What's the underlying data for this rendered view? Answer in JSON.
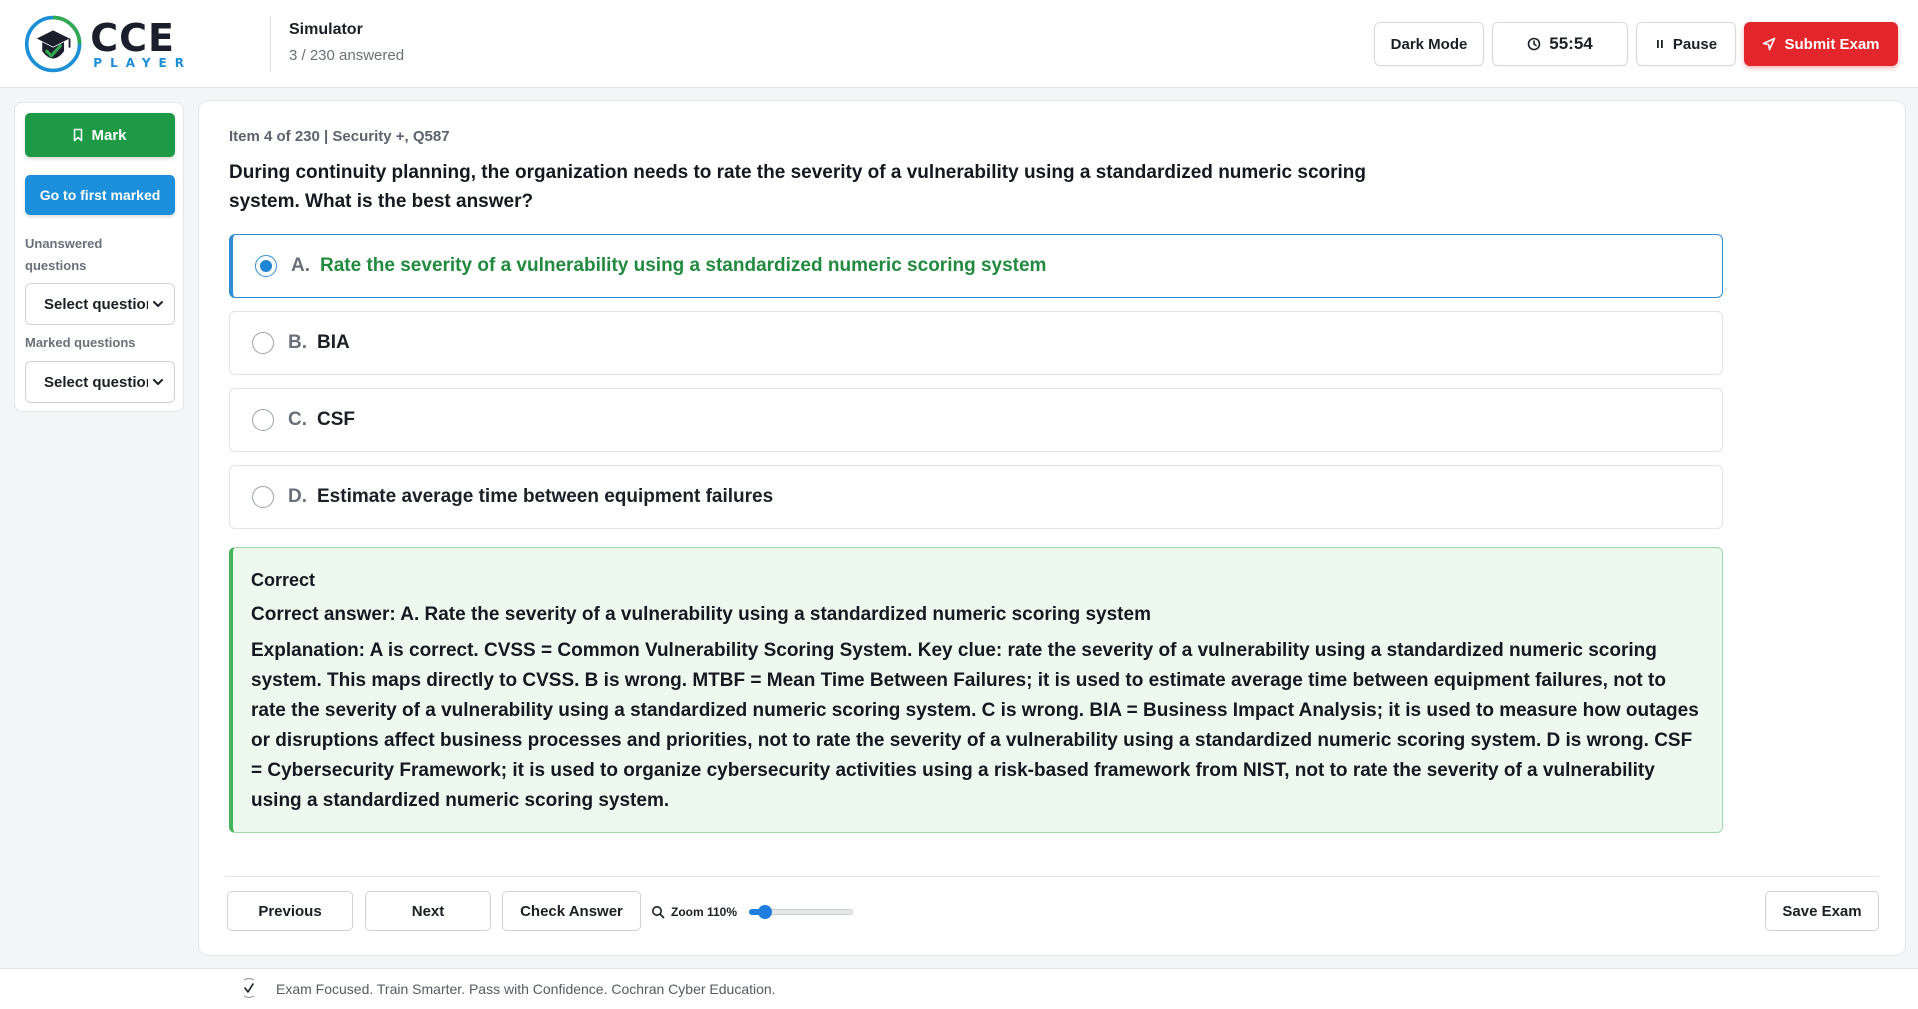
{
  "brand": {
    "name": "CCE",
    "subname": "PLAYER",
    "colors": {
      "navy": "#1a1f2b",
      "blue": "#1d8fd6",
      "green": "#32a852"
    }
  },
  "header": {
    "mode_title": "Simulator",
    "progress": "3 / 230 answered",
    "dark_mode_label": "Dark Mode",
    "timer": "55:54",
    "pause_label": "Pause",
    "submit_label": "Submit Exam",
    "icons": {
      "timer": "clock-icon",
      "pause": "pause-icon",
      "submit": "send-icon"
    }
  },
  "sidebar": {
    "mark_label": "Mark",
    "first_marked_label": "Go to first marked",
    "unanswered_label": "Unanswered questions",
    "unanswered_select": "Select question",
    "marked_label": "Marked questions",
    "marked_select": "Select question",
    "icons": {
      "mark": "bookmark-icon",
      "dropdown": "chevron-down-icon"
    }
  },
  "question": {
    "meta": "Item 4 of 230 | Security +, Q587",
    "text": "During continuity planning, the organization needs to rate the severity of a vulnerability using a standardized numeric scoring system. What is the best answer?",
    "selected": "A",
    "options": [
      {
        "letter": "A.",
        "text": "Rate the severity of a vulnerability using a standardized numeric scoring system"
      },
      {
        "letter": "B.",
        "text": "BIA"
      },
      {
        "letter": "C.",
        "text": "CSF"
      },
      {
        "letter": "D.",
        "text": "Estimate average time between equipment failures"
      }
    ]
  },
  "feedback": {
    "status": "Correct",
    "answer": "Correct answer: A. Rate the severity of a vulnerability using a standardized numeric scoring system",
    "explanation": "Explanation: A is correct. CVSS = Common Vulnerability Scoring System. Key clue: rate the severity of a vulnerability using a standardized numeric scoring system. This maps directly to CVSS. B is wrong. MTBF = Mean Time Between Failures; it is used to estimate average time between equipment failures, not to rate the severity of a vulnerability using a standardized numeric scoring system. C is wrong. BIA = Business Impact Analysis; it is used to measure how outages or disruptions affect business processes and priorities, not to rate the severity of a vulnerability using a standardized numeric scoring system. D is wrong. CSF = Cybersecurity Framework; it is used to organize cybersecurity activities using a risk-based framework from NIST, not to rate the severity of a vulnerability using a standardized numeric scoring system."
  },
  "controls": {
    "previous_label": "Previous",
    "next_label": "Next",
    "check_label": "Check Answer",
    "zoom_label": "Zoom 110%",
    "zoom_level": 0.1,
    "save_label": "Save Exam",
    "icons": {
      "zoom": "magnifier-icon"
    }
  },
  "footer": {
    "tagline": "Exam Focused. Train Smarter. Pass with Confidence. Cochran Cyber Education.",
    "icon": "checkmark-icon"
  }
}
